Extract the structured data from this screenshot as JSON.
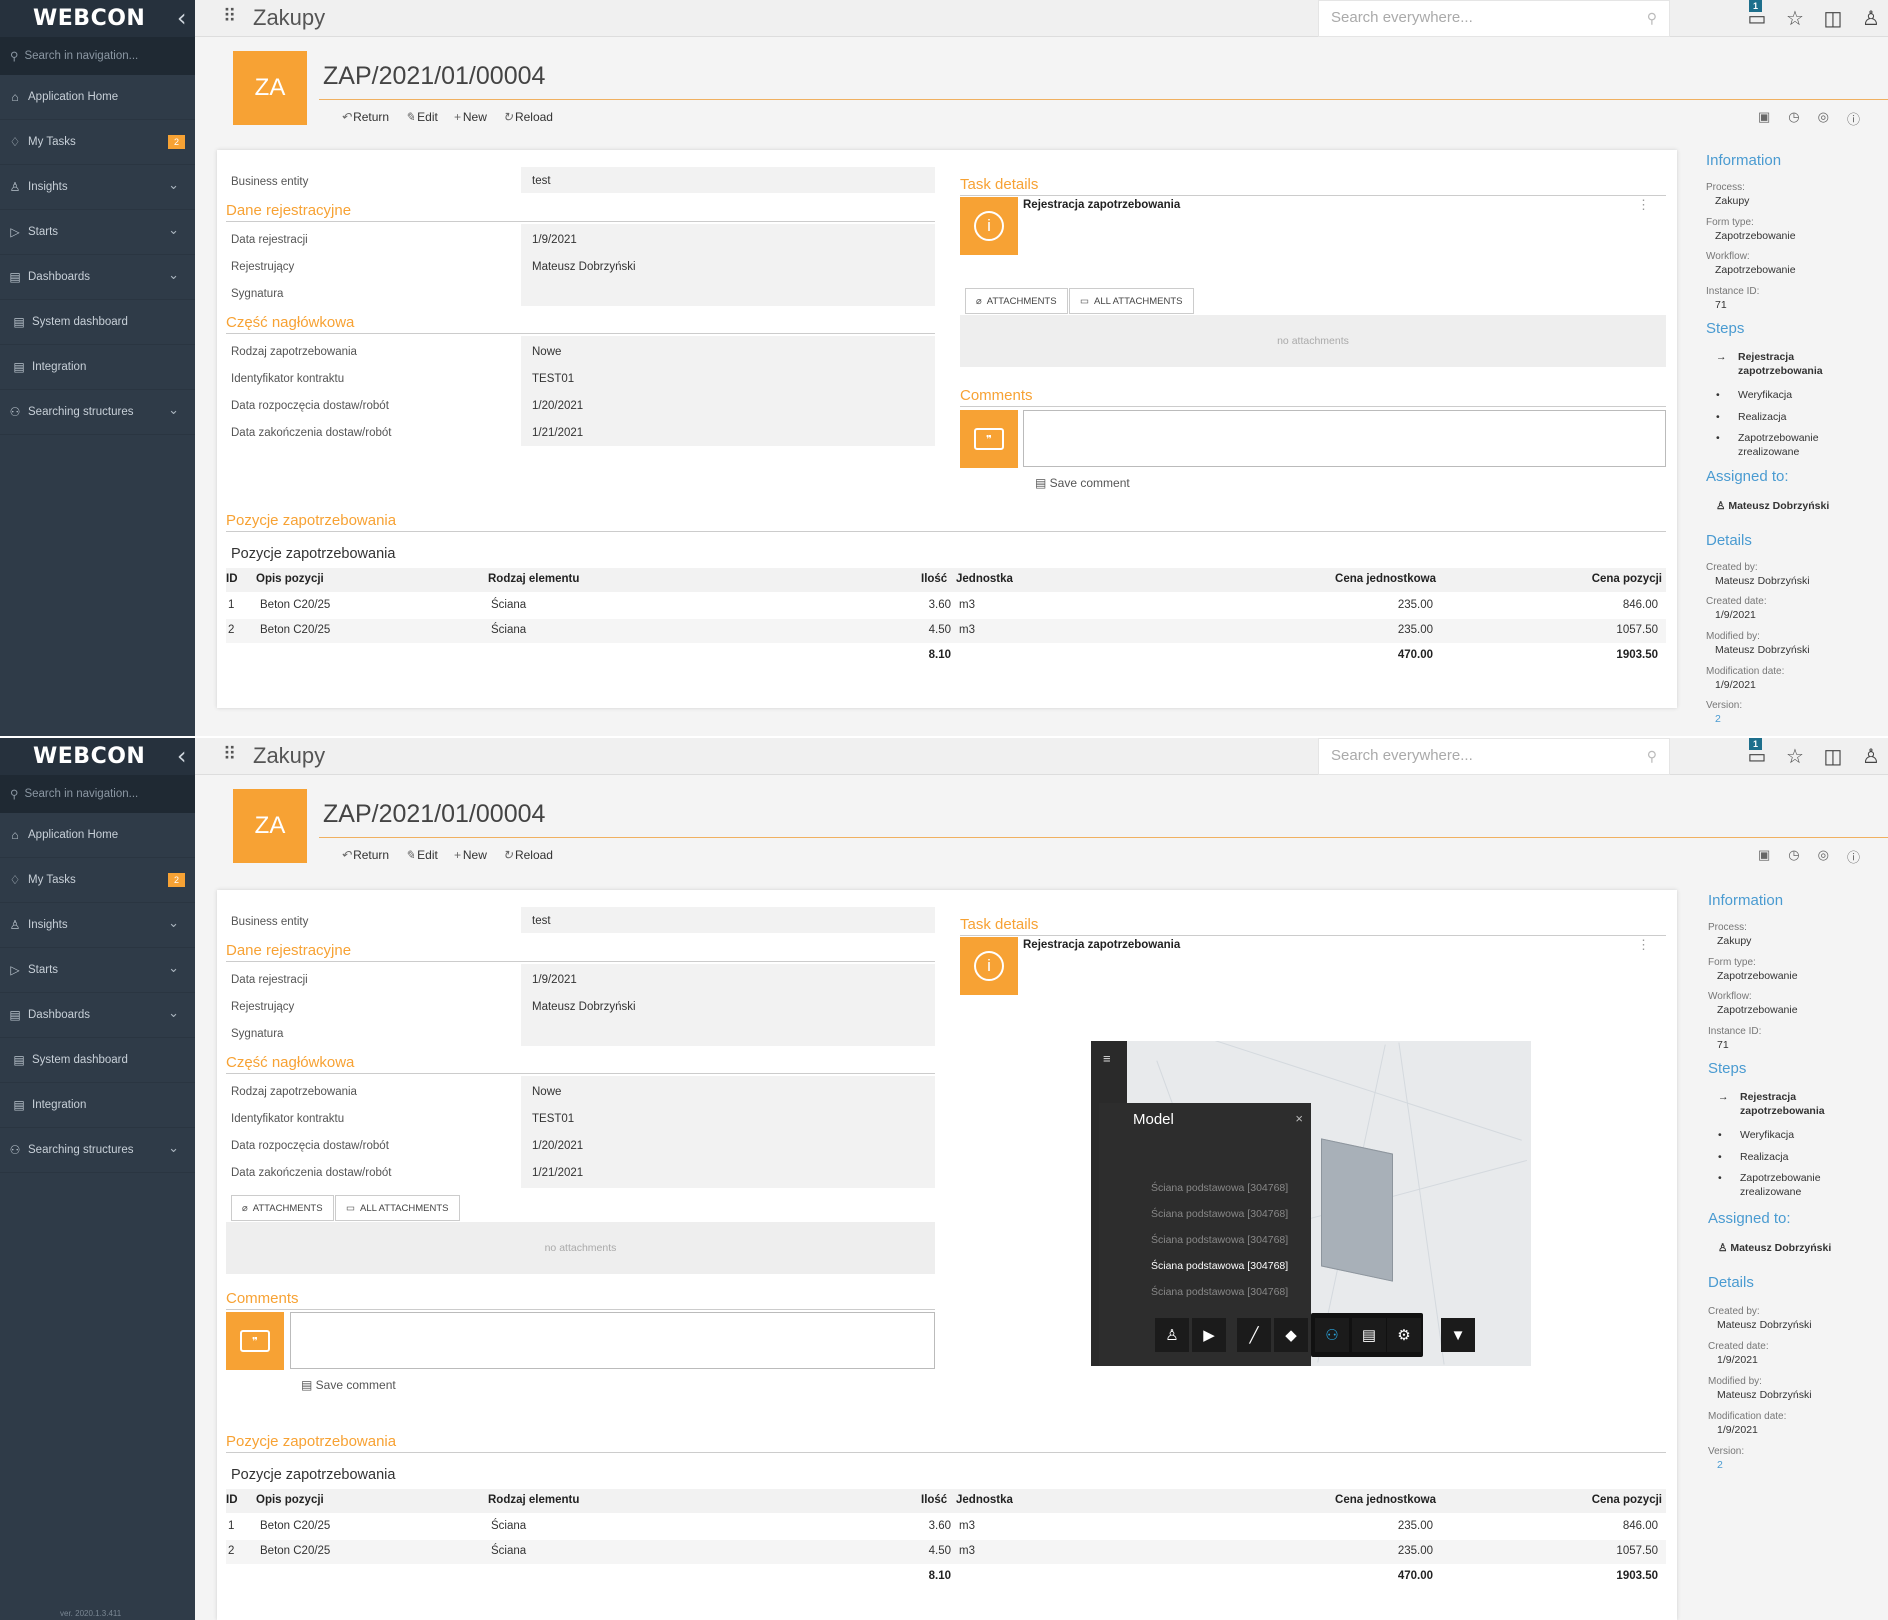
{
  "sidebar": {
    "logo": "WEBCON",
    "collapse_icon": "chevron-left-icon",
    "search_placeholder": "Search in navigation...",
    "items": [
      {
        "label": "Application Home",
        "icon": "home-icon"
      },
      {
        "label": "My Tasks",
        "icon": "bell-icon",
        "badge": "2"
      },
      {
        "label": "Insights",
        "icon": "users-icon",
        "expandable": true
      },
      {
        "label": "Starts",
        "icon": "play-icon",
        "expandable": true
      },
      {
        "label": "Dashboards",
        "icon": "dashboard-icon",
        "expandable": true
      },
      {
        "label": "System dashboard",
        "icon": "dashboard-icon"
      },
      {
        "label": "Integration",
        "icon": "dashboard-icon"
      },
      {
        "label": "Searching structures",
        "icon": "tree-icon",
        "expandable": true
      }
    ],
    "version": "ver. 2020.1.3.411"
  },
  "topbar": {
    "app_title": "Zakupy",
    "search_placeholder": "Search everywhere...",
    "notification_count": "1",
    "icons": [
      "notification-icon",
      "star-icon",
      "layout-icon",
      "user-icon"
    ]
  },
  "header": {
    "avatar": "ZA",
    "signature": "ZAP/2021/01/00004",
    "actions": [
      "Return",
      "Edit",
      "New",
      "Reload"
    ],
    "right_icons": [
      "office-icon",
      "history-icon",
      "preview-icon",
      "info-icon"
    ]
  },
  "form": {
    "business_entity_label": "Business entity",
    "business_entity_value": "test",
    "dane_section": "Dane rejestracyjne",
    "data_rejestracji_label": "Data rejestracji",
    "data_rejestracji_value": "1/9/2021",
    "rejestrujacy_label": "Rejestrujący",
    "rejestrujacy_value": "Mateusz Dobrzyński",
    "sygnatura_label": "Sygnatura",
    "czesc_section": "Część nagłówkowa",
    "rodzaj_label": "Rodzaj zapotrzebowania",
    "rodzaj_value": "Nowe",
    "identyfikator_label": "Identyfikator kontraktu",
    "identyfikator_value": "TEST01",
    "data_rozp_label": "Data rozpoczęcia dostaw/robót",
    "data_rozp_value": "1/20/2021",
    "data_zak_label": "Data zakończenia dostaw/robót",
    "data_zak_value": "1/21/2021"
  },
  "task": {
    "section": "Task details",
    "title": "Rejestracja zapotrzebowania",
    "attachments_tab": "ATTACHMENTS",
    "all_attachments_tab": "ALL ATTACHMENTS",
    "no_attachments": "no attachments",
    "comments_section": "Comments",
    "save_comment": "Save comment"
  },
  "grid": {
    "section": "Pozycje zapotrzebowania",
    "title": "Pozycje zapotrzebowania",
    "columns": [
      "ID",
      "Opis pozycji",
      "Rodzaj elementu",
      "Ilość",
      "Jednostka",
      "Cena jednostkowa",
      "Cena pozycji"
    ],
    "rows": [
      {
        "id": "1",
        "opis": "Beton C20/25",
        "rodzaj": "Ściana",
        "ilosc": "3.60",
        "jednostka": "m3",
        "cena_jedn": "235.00",
        "cena_poz": "846.00"
      },
      {
        "id": "2",
        "opis": "Beton C20/25",
        "rodzaj": "Ściana",
        "ilosc": "4.50",
        "jednostka": "m3",
        "cena_jedn": "235.00",
        "cena_poz": "1057.50"
      }
    ],
    "sum_ilosc": "8.10",
    "sum_cena_jedn": "470.00",
    "sum_cena_poz": "1903.50"
  },
  "info": {
    "information": "Information",
    "process_label": "Process:",
    "process_value": "Zakupy",
    "form_type_label": "Form type:",
    "form_type_value": "Zapotrzebowanie",
    "workflow_label": "Workflow:",
    "workflow_value": "Zapotrzebowanie",
    "instance_label": "Instance ID:",
    "instance_value": "71",
    "steps_head": "Steps",
    "steps": [
      "Rejestracja zapotrzebowania",
      "Weryfikacja",
      "Realizacja",
      "Zapotrzebowanie zrealizowane"
    ],
    "assigned_head": "Assigned to:",
    "assigned_value": "Mateusz Dobrzyński",
    "details_head": "Details",
    "created_by_label": "Created by:",
    "created_by_value": "Mateusz Dobrzyński",
    "created_date_label": "Created date:",
    "created_date_value": "1/9/2021",
    "modified_by_label": "Modified by:",
    "modified_by_value": "Mateusz Dobrzyński",
    "mod_date_label": "Modification date:",
    "mod_date_value": "1/9/2021",
    "version_label": "Version:",
    "version_value": "2"
  },
  "viewer": {
    "panel_title": "Model",
    "items": [
      "Ściana podstawowa [304768]",
      "Ściana podstawowa [304768]",
      "Ściana podstawowa [304768]",
      "Ściana podstawowa [304768]",
      "Ściana podstawowa [304768]"
    ],
    "tools": [
      "walk-icon",
      "camera-icon",
      "measure-icon",
      "explode-icon",
      "model-tree-icon",
      "properties-icon",
      "settings-icon",
      "fullscreen-icon"
    ]
  },
  "colors": {
    "accent": "#f7a234",
    "sidebar": "#2f3b48",
    "link": "#4a9bd1"
  }
}
